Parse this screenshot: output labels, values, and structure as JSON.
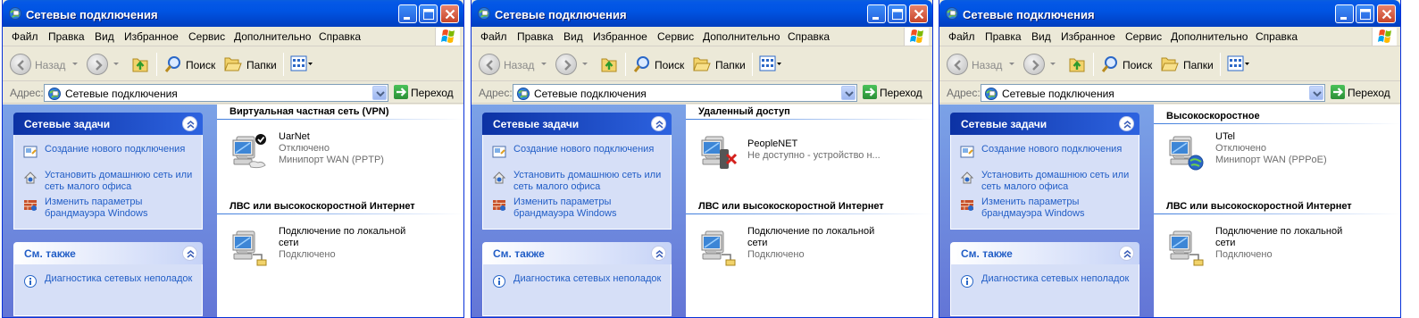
{
  "window": {
    "title": "Сетевые подключения",
    "accent": "#0054e3",
    "taskpane_color": "#6375d6",
    "link_color": "#215dc6"
  },
  "menu": [
    "Файл",
    "Правка",
    "Вид",
    "Избранное",
    "Сервис",
    "Дополнительно",
    "Справка"
  ],
  "toolbar": {
    "back_label": "Назад",
    "search_label": "Поиск",
    "folders_label": "Папки",
    "icons": [
      "back-icon",
      "forward-icon",
      "up-folder-icon",
      "search-icon",
      "folders-icon",
      "views-icon"
    ]
  },
  "address": {
    "label": "Адрес:",
    "value": "Сетевые подключения",
    "go_label": "Переход"
  },
  "taskpane": {
    "network_tasks": {
      "title": "Сетевые задачи",
      "items": [
        {
          "label": "Создание нового подключения",
          "icon": "new-connection-icon"
        },
        {
          "label": "Установить домашнюю сеть или сеть малого офиса",
          "icon": "home-network-icon"
        },
        {
          "label": "Изменить параметры брандмауэра Windows",
          "icon": "firewall-icon"
        }
      ]
    },
    "see_also": {
      "title": "См. также",
      "items": [
        {
          "label": "Диагностика сетевых неполадок",
          "icon": "info-icon"
        }
      ]
    }
  },
  "windows": [
    {
      "groups": [
        {
          "title": "Виртуальная частная сеть (VPN)",
          "connections": [
            {
              "name": "UarNet",
              "status": "Отключено",
              "device": "Минипорт WAN (PPTP)",
              "icon": "vpn-connection-icon"
            }
          ]
        },
        {
          "title": "ЛВС или высокоскоростной Интернет",
          "connections": [
            {
              "name": "Подключение по локальной сети",
              "status": "Подключено",
              "device": "",
              "icon": "lan-connection-icon"
            }
          ]
        }
      ]
    },
    {
      "groups": [
        {
          "title": "Удаленный доступ",
          "connections": [
            {
              "name": "PeopleNET",
              "status": "Не доступно - устройство н...",
              "device": "",
              "icon": "dialup-connection-icon"
            }
          ]
        },
        {
          "title": "ЛВС или высокоскоростной Интернет",
          "connections": [
            {
              "name": "Подключение по локальной сети",
              "status": "Подключено",
              "device": "",
              "icon": "lan-connection-icon"
            }
          ]
        }
      ]
    },
    {
      "groups": [
        {
          "title": "Высокоскоростное",
          "connections": [
            {
              "name": "UTel",
              "status": "Отключено",
              "device": "Минипорт WAN (PPPoE)",
              "icon": "broadband-connection-icon"
            }
          ]
        },
        {
          "title": "ЛВС или высокоскоростной Интернет",
          "connections": [
            {
              "name": "Подключение по локальной сети",
              "status": "Подключено",
              "device": "",
              "icon": "lan-connection-icon"
            }
          ]
        }
      ]
    }
  ]
}
